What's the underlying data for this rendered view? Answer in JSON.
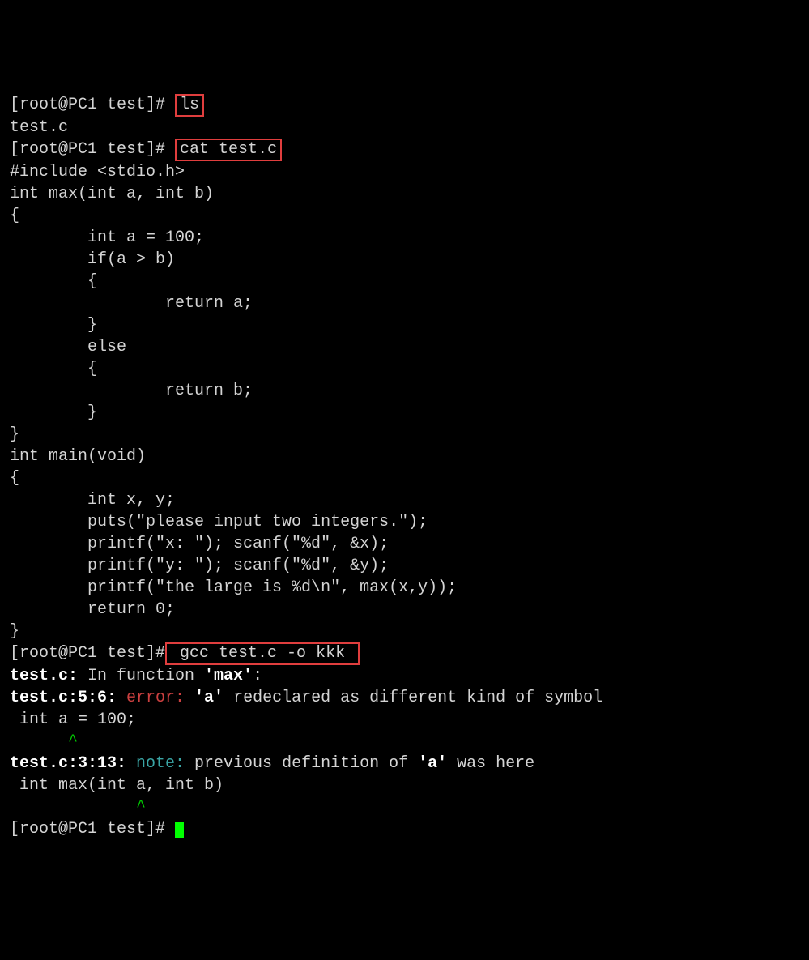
{
  "prompt1": "[root@PC1 test]# ",
  "cmd1": "ls",
  "ls_output": "test.c",
  "prompt2": "[root@PC1 test]# ",
  "cmd2": "cat test.c",
  "code": {
    "l1": "#include <stdio.h>",
    "l2": "",
    "l3": "int max(int a, int b)",
    "l4": "{",
    "l5": "        int a = 100;",
    "l6": "        if(a > b)",
    "l7": "        {",
    "l8": "                return a;",
    "l9": "        }",
    "l10": "        else",
    "l11": "        {",
    "l12": "                return b;",
    "l13": "        }",
    "l14": "}",
    "l15": "",
    "l16": "int main(void)",
    "l17": "{",
    "l18": "        int x, y;",
    "l19": "",
    "l20": "        puts(\"please input two integers.\");",
    "l21": "        printf(\"x: \"); scanf(\"%d\", &x);",
    "l22": "        printf(\"y: \"); scanf(\"%d\", &y);",
    "l23": "",
    "l24": "        printf(\"the large is %d\\n\", max(x,y));",
    "l25": "",
    "l26": "        return 0;",
    "l27": "}"
  },
  "prompt3": "[root@PC1 test]#",
  "cmd3": " gcc test.c -o kkk ",
  "err": {
    "file1": "test.c:",
    "fn": " In function ",
    "fnname": "'max'",
    "colon1": ":",
    "loc1": "test.c:5:6: ",
    "error_label": "error: ",
    "var_a1": "'a'",
    "err_msg": " redeclared as different kind of symbol",
    "src1": " int a = 100;",
    "caret1": "      ^",
    "loc2": "test.c:3:13: ",
    "note_label": "note: ",
    "note_msg": "previous definition of ",
    "var_a2": "'a'",
    "note_suffix": " was here",
    "src2": " int max(int a, int b)",
    "caret2": "             ^"
  },
  "prompt4": "[root@PC1 test]# "
}
